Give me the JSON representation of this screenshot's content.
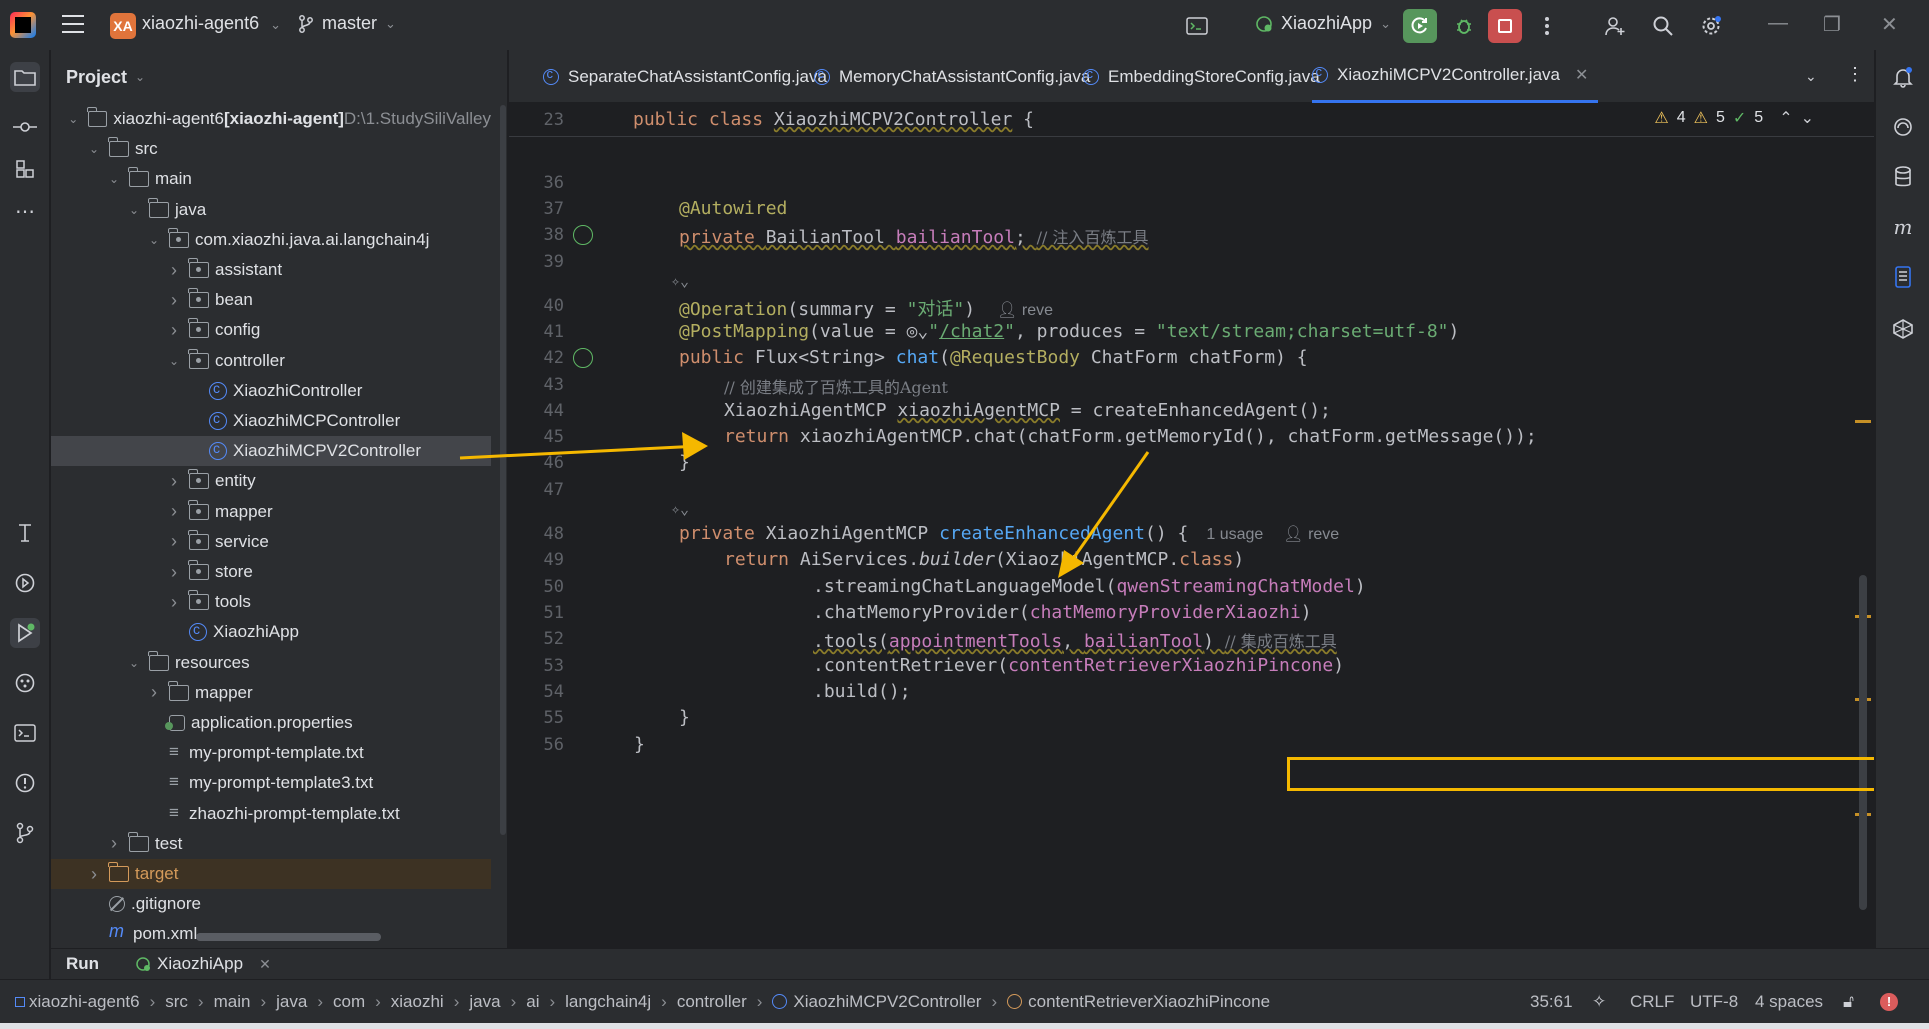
{
  "titlebar": {
    "project_badge": "XA",
    "project_name": "xiaozhi-agent6",
    "branch": "master",
    "run_config": "XiaozhiApp"
  },
  "project_panel": {
    "title": "Project",
    "tree": [
      {
        "label": "xiaozhi-agent6",
        "suffix": "[xiaozhi-agent]",
        "path": "D:\\1.StudySiliValley",
        "depth": 0,
        "type": "module",
        "expanded": true
      },
      {
        "label": "src",
        "depth": 1,
        "type": "folder",
        "expanded": true
      },
      {
        "label": "main",
        "depth": 2,
        "type": "folder",
        "expanded": true
      },
      {
        "label": "java",
        "depth": 3,
        "type": "source-folder",
        "expanded": true
      },
      {
        "label": "com.xiaozhi.java.ai.langchain4j",
        "depth": 4,
        "type": "package",
        "expanded": true
      },
      {
        "label": "assistant",
        "depth": 5,
        "type": "package",
        "expanded": false
      },
      {
        "label": "bean",
        "depth": 5,
        "type": "package",
        "expanded": false
      },
      {
        "label": "config",
        "depth": 5,
        "type": "package",
        "expanded": false
      },
      {
        "label": "controller",
        "depth": 5,
        "type": "package",
        "expanded": true
      },
      {
        "label": "XiaozhiController",
        "depth": 6,
        "type": "class"
      },
      {
        "label": "XiaozhiMCPController",
        "depth": 6,
        "type": "class"
      },
      {
        "label": "XiaozhiMCPV2Controller",
        "depth": 6,
        "type": "class",
        "selected": true
      },
      {
        "label": "entity",
        "depth": 5,
        "type": "package",
        "expanded": false
      },
      {
        "label": "mapper",
        "depth": 5,
        "type": "package",
        "expanded": false
      },
      {
        "label": "service",
        "depth": 5,
        "type": "package",
        "expanded": false
      },
      {
        "label": "store",
        "depth": 5,
        "type": "package",
        "expanded": false
      },
      {
        "label": "tools",
        "depth": 5,
        "type": "package",
        "expanded": false
      },
      {
        "label": "XiaozhiApp",
        "depth": 5,
        "type": "app-class"
      },
      {
        "label": "resources",
        "depth": 3,
        "type": "resource-folder",
        "expanded": true
      },
      {
        "label": "mapper",
        "depth": 4,
        "type": "folder",
        "expanded": false
      },
      {
        "label": "application.properties",
        "depth": 4,
        "type": "properties"
      },
      {
        "label": "my-prompt-template.txt",
        "depth": 4,
        "type": "text"
      },
      {
        "label": "my-prompt-template3.txt",
        "depth": 4,
        "type": "text"
      },
      {
        "label": "zhaozhi-prompt-template.txt",
        "depth": 4,
        "type": "text"
      },
      {
        "label": "test",
        "depth": 2,
        "type": "folder",
        "expanded": false
      },
      {
        "label": "target",
        "depth": 1,
        "type": "excluded-folder",
        "expanded": false
      },
      {
        "label": ".gitignore",
        "depth": 1,
        "type": "gitignore"
      },
      {
        "label": "pom.xml",
        "depth": 1,
        "type": "maven"
      }
    ]
  },
  "editor": {
    "tabs": [
      {
        "label": "SeparateChatAssistantConfig.java",
        "active": false
      },
      {
        "label": "MemoryChatAssistantConfig.java",
        "active": false
      },
      {
        "label": "EmbeddingStoreConfig.java",
        "active": false
      },
      {
        "label": "XiaozhiMCPV2Controller.java",
        "active": true
      }
    ],
    "inspections": {
      "warnings_a": "4",
      "warnings_b": "5",
      "ok": "5"
    },
    "sticky_line": {
      "number": "23",
      "text_kw": "public class ",
      "text_name": "XiaozhiMCPV2Controller",
      "text_rest": " {"
    },
    "lines": [
      {
        "n": "36"
      },
      {
        "n": "37",
        "ann": "@Autowired"
      },
      {
        "n": "38",
        "kw": "private ",
        "type": "BailianTool ",
        "field": "bailianTool",
        "rest": "; ",
        "comment": "// 注入百炼工具"
      },
      {
        "n": "39"
      },
      {
        "n": "40",
        "ann": "@Operation",
        "p1": "(summary = ",
        "s1": "\"对话\"",
        "p2": ")",
        "author": "reve"
      },
      {
        "n": "41",
        "ann": "@PostMapping",
        "p1": "(value = ",
        "s1a": "\"",
        "s1b": "/chat2",
        "s1c": "\"",
        "p2": ", produces = ",
        "s2": "\"text/stream;charset=utf-8\"",
        "p3": ")"
      },
      {
        "n": "42",
        "kw": "public ",
        "t1": "Flux<String> ",
        "fn": "chat",
        "p1": "(",
        "ann": "@RequestBody",
        "p2": " ChatForm chatForm) {"
      },
      {
        "n": "43",
        "comment": "// 创建集成了百炼工具的Agent"
      },
      {
        "n": "44",
        "t1": "XiaozhiAgentMCP ",
        "var": "xiaozhiAgentMCP",
        "rest": " = createEnhancedAgent();"
      },
      {
        "n": "45",
        "kw": "return ",
        "rest": "xiaozhiAgentMCP.chat(chatForm.getMemoryId(), chatForm.getMessage());"
      },
      {
        "n": "46",
        "rest": "}"
      },
      {
        "n": "47"
      },
      {
        "n": "48",
        "kw": "private ",
        "t1": "XiaozhiAgentMCP ",
        "fn": "createEnhancedAgent",
        "rest": "() {",
        "usage": "1 usage",
        "author": "reve"
      },
      {
        "n": "49",
        "kw": "return ",
        "t1": "AiServices.",
        "it": "builder",
        "p1": "(XiaozhiAgentMCP.",
        "kw2": "class",
        "p2": ")"
      },
      {
        "n": "50",
        "p1": ".streamingChatLanguageModel(",
        "fld": "qwenStreamingChatModel",
        "p2": ")"
      },
      {
        "n": "51",
        "p1": ".chatMemoryProvider(",
        "fld": "chatMemoryProviderXiaozhi",
        "p2": ")"
      },
      {
        "n": "52",
        "p1": ".tools(",
        "fld1": "appointmentTools",
        "p2": ", ",
        "fld2": "bailianTool",
        "p3": ") ",
        "comment": "// 集成百炼工具"
      },
      {
        "n": "53",
        "p1": ".contentRetriever(",
        "fld": "contentRetrieverXiaozhiPincone",
        "p2": ")"
      },
      {
        "n": "54",
        "p1": ".build();"
      },
      {
        "n": "55",
        "p1": "}"
      },
      {
        "n": "56",
        "p1": "}"
      }
    ]
  },
  "runbar": {
    "tab_run": "Run",
    "tab_app": "XiaozhiApp"
  },
  "statusbar": {
    "breadcrumbs": [
      "xiaozhi-agent6",
      "src",
      "main",
      "java",
      "com",
      "xiaozhi",
      "java",
      "ai",
      "langchain4j",
      "controller",
      "XiaozhiMCPV2Controller",
      "contentRetrieverXiaozhiPincone"
    ],
    "cursor": "35:61",
    "line_sep": "CRLF",
    "encoding": "UTF-8",
    "indent": "4 spaces"
  },
  "colors": {
    "accent": "#3574f0",
    "arrow": "#f5b800",
    "highlight_box": "#f5b800",
    "run_green": "#57965c",
    "stop_red": "#c94f4f"
  }
}
